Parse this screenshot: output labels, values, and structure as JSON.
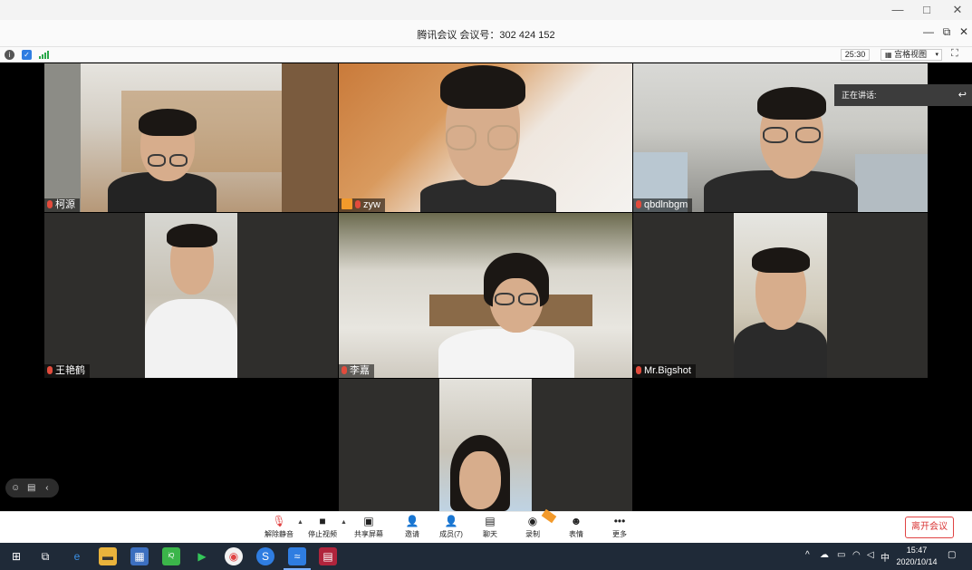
{
  "window": {
    "title": "腾讯会议 会议号：302 424 152",
    "minimize_icon": "minimize-icon",
    "maximize_icon": "maximize-icon",
    "close_icon": "close-icon"
  },
  "info_bar": {
    "timer": "25:30",
    "view_label": "宫格视图"
  },
  "speaking_label": "正在讲话:",
  "participants": [
    {
      "name": "柯源",
      "muted": true
    },
    {
      "name": "zyw",
      "muted": true,
      "host": true
    },
    {
      "name": "qbdlnbgm",
      "muted": true
    },
    {
      "name": "王艳鹤",
      "muted": true
    },
    {
      "name": "李嘉",
      "muted": true
    },
    {
      "name": "Mr.Bigshot",
      "muted": true
    },
    {
      "name": "",
      "muted": false
    }
  ],
  "toolbar": {
    "mute_label": "解除静音",
    "video_label": "停止视频",
    "share_label": "共享屏幕",
    "invite_label": "邀请",
    "members_label": "成员(7)",
    "chat_label": "聊天",
    "record_label": "录制",
    "emoji_label": "表情",
    "more_label": "更多",
    "leave_label": "离开会议"
  },
  "taskbar": {
    "time": "15:47",
    "date": "2020/10/14",
    "ime": "中"
  },
  "colors": {
    "accent_red": "#e04343",
    "tile_bg": "#2f2e2c",
    "taskbar_bg": "#1f2a38"
  }
}
